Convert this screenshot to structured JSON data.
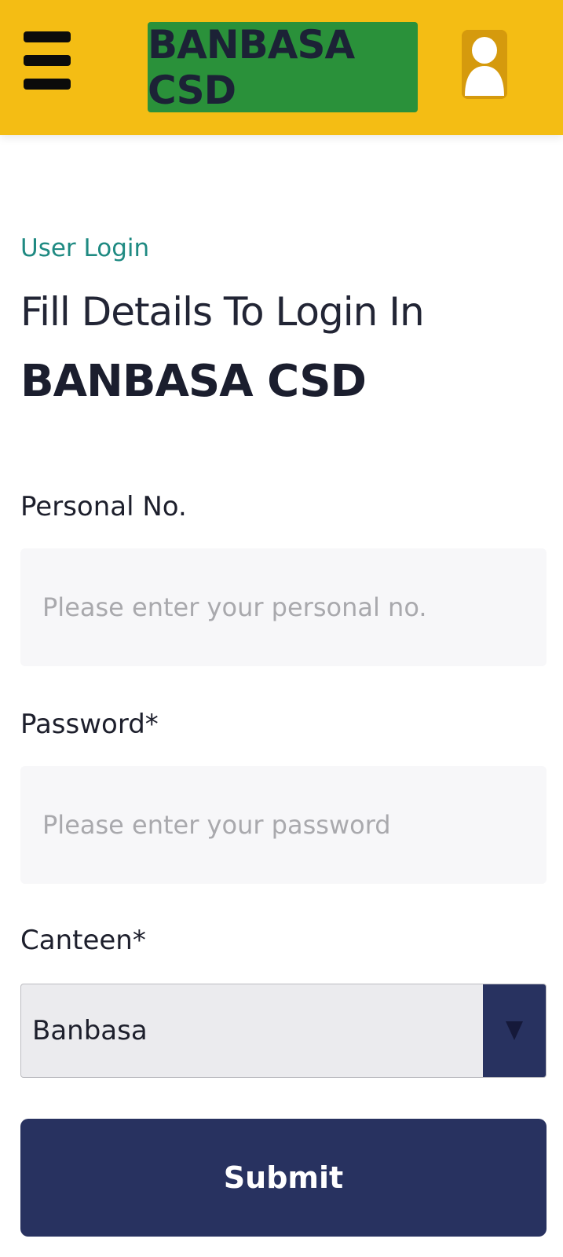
{
  "header": {
    "brand_title": "BANBASA CSD",
    "menu_icon": "hamburger-menu-icon",
    "user_icon": "user-avatar-icon",
    "bg_color": "#f4bd14",
    "brand_bg_color": "#2a913a"
  },
  "login": {
    "eyebrow": "User Login",
    "title": "Fill Details To Login In",
    "title_strong": "BANBASA CSD"
  },
  "form": {
    "personal_no": {
      "label": "Personal No.",
      "placeholder": "Please enter your personal no."
    },
    "password": {
      "label": "Password*",
      "placeholder": "Please enter your password"
    },
    "canteen": {
      "label": "Canteen*",
      "selected": "Banbasa",
      "arrow_icon": "caret-down-icon"
    },
    "submit_label": "Submit",
    "primary_color": "#283260"
  }
}
